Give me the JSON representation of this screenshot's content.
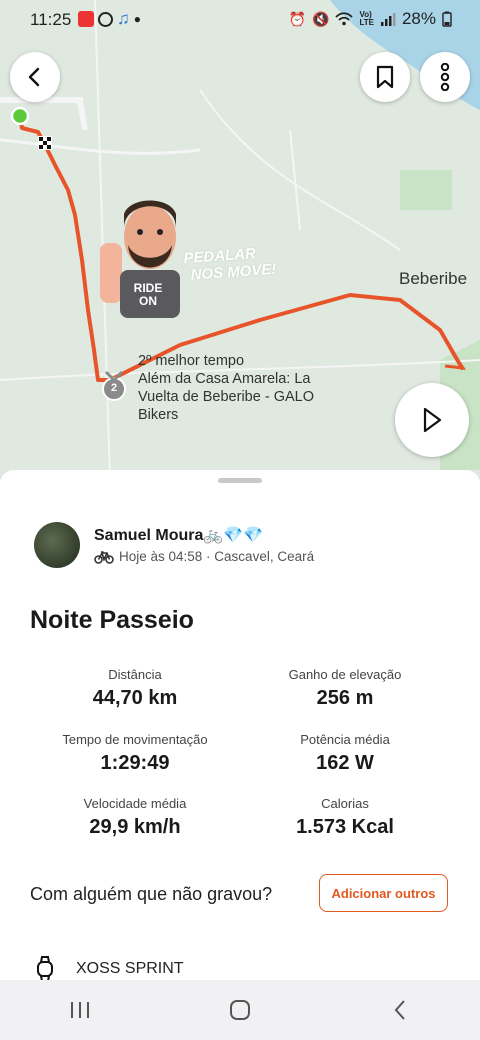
{
  "status_bar": {
    "time": "11:25",
    "battery": "28%",
    "app_icons": [
      "photo-app-icon",
      "whatsapp-icon",
      "music-icon"
    ],
    "system_icons": [
      "alarm-icon",
      "mute-icon",
      "wifi-icon",
      "lte-icon",
      "signal-icon",
      "battery-icon"
    ]
  },
  "map": {
    "town_label": "Beberibe",
    "watermark_line1": "PEDALAR",
    "watermark_line2": "NOS MOVE!",
    "avatar_shirt_text_1": "RIDE",
    "avatar_shirt_text_2": "ON",
    "medal_number": "2",
    "segment_achievement_line1": "2º melhor tempo",
    "segment_achievement_line2": "Além da Casa Amarela: La Vuelta de Beberibe - GALO Bikers",
    "route_color": "#e8542a",
    "start_marker_color": "#5cc93b"
  },
  "activity": {
    "athlete_name": "Samuel Moura🚲💎💎",
    "timestamp_location": "Hoje às 04:58 · Cascavel, Ceará",
    "title": "Noite Passeio",
    "stats": [
      {
        "label": "Distância",
        "value": "44,70 km"
      },
      {
        "label": "Ganho de elevação",
        "value": "256 m"
      },
      {
        "label": "Tempo de movimentação",
        "value": "1:29:49"
      },
      {
        "label": "Potência média",
        "value": "162 W"
      },
      {
        "label": "Velocidade média",
        "value": "29,9 km/h"
      },
      {
        "label": "Calorias",
        "value": "1.573 Kcal"
      }
    ],
    "with_someone_prompt": "Com alguém que não gravou?",
    "add_others_label": "Adicionar outros",
    "device_name": "XOSS SPRINT",
    "accent_color": "#e05a21"
  }
}
